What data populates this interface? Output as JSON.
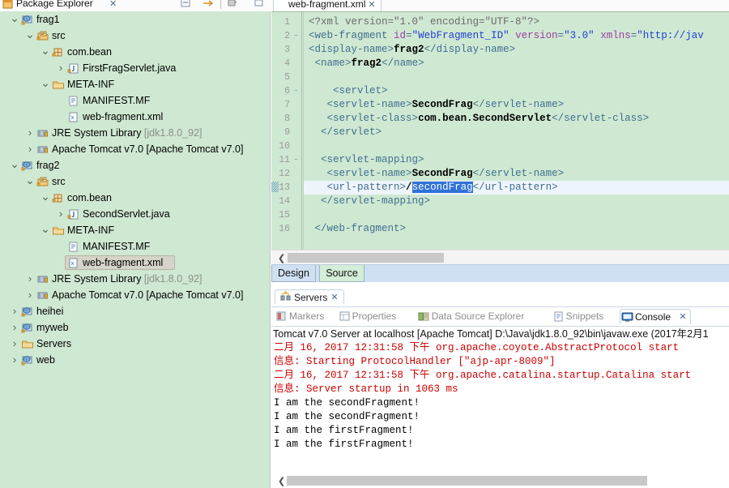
{
  "package_explorer": {
    "title": "Package Explorer",
    "close_label": "✕",
    "toolbar": [
      {
        "name": "collapse-all-button",
        "glyph": "▤"
      },
      {
        "name": "link-with-editor-button",
        "glyph": "⇨"
      },
      {
        "name": "view-menu-button",
        "glyph": "▼"
      },
      {
        "name": "minimize-button",
        "glyph": "▭"
      }
    ],
    "tree": [
      {
        "label": "frag1",
        "indent": 0,
        "arrow": "v",
        "icon": "web-project-icon",
        "selected": false
      },
      {
        "label": "src",
        "indent": 1,
        "arrow": "v",
        "icon": "source-folder-icon",
        "selected": false
      },
      {
        "label": "com.bean",
        "indent": 2,
        "arrow": "v",
        "icon": "package-icon",
        "selected": false
      },
      {
        "label": "FirstFragServlet.java",
        "indent": 3,
        "arrow": ">",
        "icon": "java-file-icon",
        "selected": false
      },
      {
        "label": "META-INF",
        "indent": 2,
        "arrow": "v",
        "icon": "folder-icon",
        "selected": false
      },
      {
        "label": "MANIFEST.MF",
        "indent": 3,
        "arrow": "",
        "icon": "manifest-file-icon",
        "selected": false
      },
      {
        "label": "web-fragment.xml",
        "indent": 3,
        "arrow": "",
        "icon": "xml-file-icon",
        "selected": false
      },
      {
        "label": "JRE System Library",
        "suffix": "[jdk1.8.0_92]",
        "indent": 1,
        "arrow": ">",
        "icon": "library-icon",
        "selected": false
      },
      {
        "label": "Apache Tomcat v7.0 [Apache Tomcat v7.0]",
        "indent": 1,
        "arrow": ">",
        "icon": "library-icon",
        "selected": false
      },
      {
        "label": "frag2",
        "indent": 0,
        "arrow": "v",
        "icon": "web-project-icon",
        "selected": false
      },
      {
        "label": "src",
        "indent": 1,
        "arrow": "v",
        "icon": "source-folder-icon",
        "selected": false
      },
      {
        "label": "com.bean",
        "indent": 2,
        "arrow": "v",
        "icon": "package-icon",
        "selected": false
      },
      {
        "label": "SecondServlet.java",
        "indent": 3,
        "arrow": ">",
        "icon": "java-file-icon",
        "selected": false
      },
      {
        "label": "META-INF",
        "indent": 2,
        "arrow": "v",
        "icon": "folder-icon",
        "selected": false
      },
      {
        "label": "MANIFEST.MF",
        "indent": 3,
        "arrow": "",
        "icon": "manifest-file-icon",
        "selected": false
      },
      {
        "label": "web-fragment.xml",
        "indent": 3,
        "arrow": "",
        "icon": "xml-file-icon",
        "selected": true
      },
      {
        "label": "JRE System Library",
        "suffix": "[jdk1.8.0_92]",
        "indent": 1,
        "arrow": ">",
        "icon": "library-icon",
        "selected": false
      },
      {
        "label": "Apache Tomcat v7.0 [Apache Tomcat v7.0]",
        "indent": 1,
        "arrow": ">",
        "icon": "library-icon",
        "selected": false
      },
      {
        "label": "heihei",
        "indent": 0,
        "arrow": ">",
        "icon": "web-project-icon",
        "selected": false
      },
      {
        "label": "myweb",
        "indent": 0,
        "arrow": ">",
        "icon": "web-project-icon",
        "selected": false
      },
      {
        "label": "Servers",
        "indent": 0,
        "arrow": ">",
        "icon": "folder-icon",
        "selected": false
      },
      {
        "label": "web",
        "indent": 0,
        "arrow": ">",
        "icon": "web-project-icon",
        "selected": false
      }
    ]
  },
  "editor": {
    "tab_label": "web-fragment.xml",
    "tab_close": "✕",
    "tab_icon": "xml-file-icon",
    "current_line": 13,
    "selection_text": "secondFrag",
    "lines": [
      {
        "n": 1,
        "fold": false,
        "indent": 0
      },
      {
        "n": 2,
        "fold": true,
        "indent": 0
      },
      {
        "n": 3,
        "fold": false,
        "indent": 0
      },
      {
        "n": 4,
        "fold": false,
        "indent": 0
      },
      {
        "n": 5,
        "fold": false,
        "indent": 0
      },
      {
        "n": 6,
        "fold": true,
        "indent": 0
      },
      {
        "n": 7,
        "fold": false,
        "indent": 0
      },
      {
        "n": 8,
        "fold": false,
        "indent": 0
      },
      {
        "n": 9,
        "fold": false,
        "indent": 0
      },
      {
        "n": 10,
        "fold": false,
        "indent": 0
      },
      {
        "n": 11,
        "fold": true,
        "indent": 0
      },
      {
        "n": 12,
        "fold": false,
        "indent": 0
      },
      {
        "n": 13,
        "fold": false,
        "indent": 0
      },
      {
        "n": 14,
        "fold": false,
        "indent": 0
      },
      {
        "n": 15,
        "fold": false,
        "indent": 0
      },
      {
        "n": 16,
        "fold": false,
        "indent": 0
      }
    ],
    "source_text": [
      "<?xml version=\"1.0\" encoding=\"UTF-8\"?>",
      "<web-fragment id=\"WebFragment_ID\" version=\"3.0\" xmlns=\"http://jav",
      "<display-name>frag2</display-name>",
      " <name>frag2</name>",
      "",
      "    <servlet>",
      "   <servlet-name>SecondFrag</servlet-name>",
      "   <servlet-class>com.bean.SecondServlet</servlet-class>",
      "  </servlet>",
      "",
      "  <servlet-mapping>",
      "   <servlet-name>SecondFrag</servlet-name>",
      "   <url-pattern>/secondFrag</url-pattern>",
      "  </servlet-mapping>",
      "",
      " </web-fragment>"
    ],
    "hscroll_arrow": "❮",
    "page_tabs": [
      {
        "label": "Design",
        "active": false
      },
      {
        "label": "Source",
        "active": true
      }
    ]
  },
  "servers_view": {
    "tab_label": "Servers",
    "tab_close": "✕",
    "tab_icon": "servers-icon"
  },
  "bottom_panel": {
    "tabs": [
      {
        "label": "Markers",
        "icon": "markers-icon",
        "active": false
      },
      {
        "label": "Properties",
        "icon": "properties-icon",
        "active": false
      },
      {
        "label": "Data Source Explorer",
        "icon": "data-source-icon",
        "active": false
      },
      {
        "label": "Snippets",
        "icon": "snippets-icon",
        "active": false
      },
      {
        "label": "Console",
        "icon": "console-icon",
        "active": true
      }
    ],
    "console_close": "✕",
    "console_header": "Tomcat v7.0 Server at localhost [Apache Tomcat] D:\\Java\\jdk1.8.0_92\\bin\\javaw.exe (2017年2月1",
    "console_lines": [
      {
        "text": "二月 16, 2017 12:31:58 下午 org.apache.coyote.AbstractProtocol start",
        "stream": "err"
      },
      {
        "text": "信息: Starting ProtocolHandler [\"ajp-apr-8009\"]",
        "stream": "err"
      },
      {
        "text": "二月 16, 2017 12:31:58 下午 org.apache.catalina.startup.Catalina start",
        "stream": "err"
      },
      {
        "text": "信息: Server startup in 1063 ms",
        "stream": "err"
      },
      {
        "text": "I am the secondFragment!",
        "stream": "out"
      },
      {
        "text": "I am the secondFragment!",
        "stream": "out"
      },
      {
        "text": "I am the firstFragment!",
        "stream": "out"
      },
      {
        "text": "I am the firstFragment!",
        "stream": "out"
      }
    ],
    "hscroll_arrow": "❮"
  },
  "colors": {
    "panel_green": "#cfe8d2",
    "selection_blue": "#2f72d8",
    "console_error": "#cc0000",
    "tab_active_green": "#d3edd6"
  }
}
